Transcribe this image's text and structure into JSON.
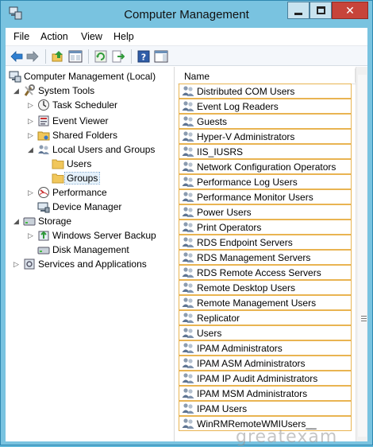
{
  "window": {
    "title": "Computer Management",
    "close_glyph": "✕"
  },
  "menu": {
    "items": [
      "File",
      "Action",
      "View",
      "Help"
    ]
  },
  "toolbar": {
    "buttons": [
      "back-icon",
      "forward-icon",
      "up-icon",
      "show-hide-tree-icon",
      "refresh-icon",
      "export-list-icon",
      "help-icon",
      "show-hide-action-pane-icon"
    ]
  },
  "tree": {
    "root": "Computer Management (Local)",
    "system_tools": "System Tools",
    "task_scheduler": "Task Scheduler",
    "event_viewer": "Event Viewer",
    "shared_folders": "Shared Folders",
    "local_users_groups": "Local Users and Groups",
    "users": "Users",
    "groups": "Groups",
    "performance": "Performance",
    "device_manager": "Device Manager",
    "storage": "Storage",
    "windows_server_backup": "Windows Server Backup",
    "disk_management": "Disk Management",
    "services_apps": "Services and Applications"
  },
  "list": {
    "column_name": "Name",
    "rows": [
      "Distributed COM Users",
      "Event Log Readers",
      "Guests",
      "Hyper-V Administrators",
      "IIS_IUSRS",
      "Network Configuration Operators",
      "Performance Log Users",
      "Performance Monitor Users",
      "Power Users",
      "Print Operators",
      "RDS Endpoint Servers",
      "RDS Management Servers",
      "RDS Remote Access Servers",
      "Remote Desktop Users",
      "Remote Management Users",
      "Replicator",
      "Users",
      "IPAM Administrators",
      "IPAM ASM Administrators",
      "IPAM IP Audit Administrators",
      "IPAM MSM Administrators",
      "IPAM Users",
      "WinRMRemoteWMIUsers__"
    ]
  },
  "watermark": "greatexam",
  "colors": {
    "window_frame": "#79c3e0",
    "row_border": "#e9b452",
    "close_button": "#c7443a",
    "selection": "#e5f1fb"
  }
}
